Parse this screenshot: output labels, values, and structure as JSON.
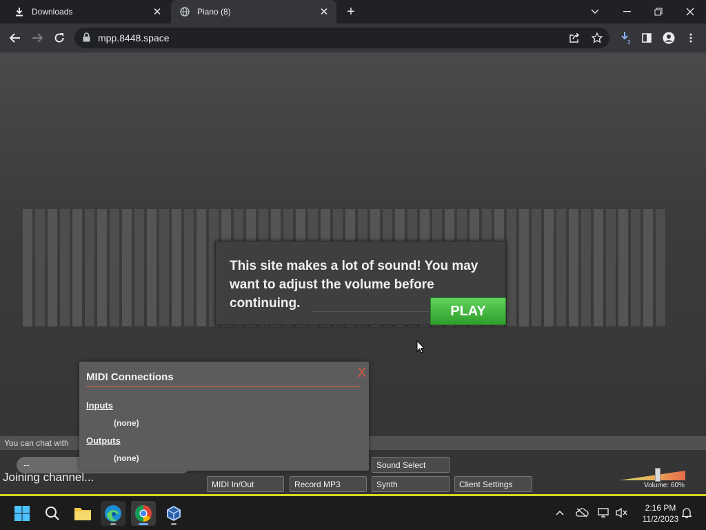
{
  "browser": {
    "tabs": [
      {
        "label": "Downloads",
        "icon": "download-icon",
        "active": false
      },
      {
        "label": "Piano (8)",
        "icon": "globe-icon",
        "active": true
      }
    ],
    "url": "mpp.8448.space"
  },
  "page": {
    "notice": {
      "text": "This site makes a lot of sound! You may want to adjust the volume before continuing.",
      "play_label": "PLAY"
    },
    "chat": {
      "hint": "You can chat with",
      "input_value": "--"
    },
    "status": "Joining channel...",
    "buttons": {
      "midi": "MIDI In/Out",
      "record": "Record MP3",
      "sound_select": "Sound Select",
      "synth": "Synth",
      "client_settings": "Client Settings"
    },
    "midi_panel": {
      "title": "MIDI Connections",
      "close": "X",
      "inputs_label": "Inputs",
      "inputs_value": "(none)",
      "outputs_label": "Outputs",
      "outputs_value": "(none)"
    },
    "volume": {
      "label": "Volume: 60%",
      "level": 0.6
    },
    "colors": {
      "play_green": "#3cb83a",
      "accent_orange": "#d9643e",
      "strip_yellow": "#d8d820"
    }
  },
  "taskbar": {
    "time": "2:16 PM",
    "date": "11/2/2023"
  }
}
